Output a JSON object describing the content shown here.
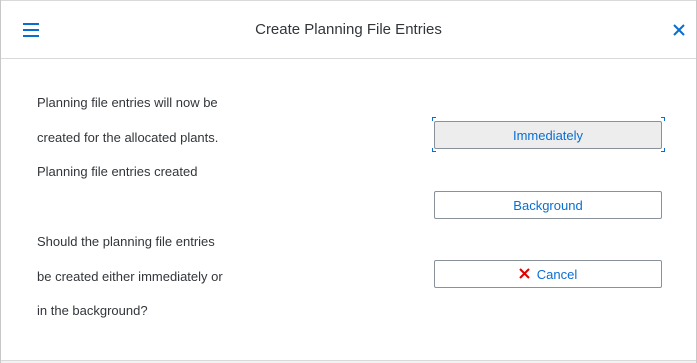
{
  "dialog": {
    "title": "Create Planning File Entries",
    "menu_icon": "hamburger-menu-icon",
    "close_icon": "close-icon"
  },
  "message": {
    "lines": [
      "Planning file entries will now be",
      "created for the allocated plants.",
      "Planning file entries created",
      "Should the planning file entries",
      "be created either immediately or",
      "in the background?"
    ]
  },
  "buttons": {
    "immediately": "Immediately",
    "background": "Background",
    "cancel": "Cancel",
    "cancel_icon": "cross-icon"
  },
  "colors": {
    "accent": "#0a6ed1",
    "cancel_icon": "#e00000",
    "text": "#32363a"
  }
}
